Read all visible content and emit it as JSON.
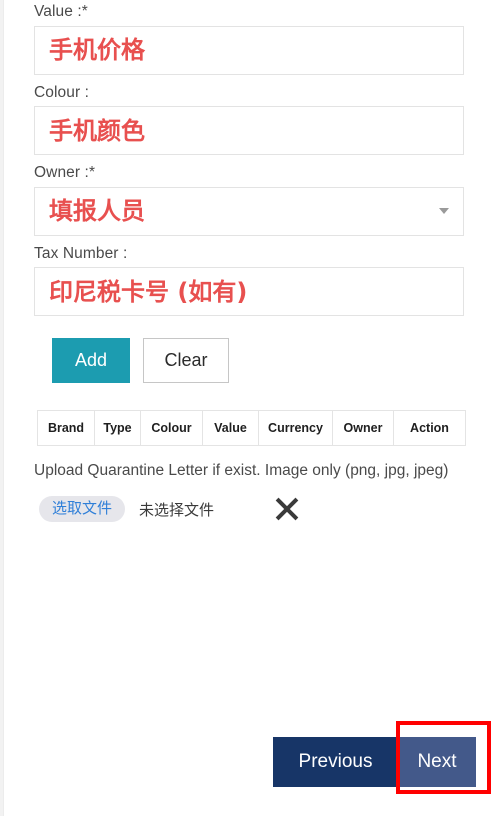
{
  "form": {
    "fields": [
      {
        "label": "Value :*",
        "value": "手机价格",
        "type": "text",
        "name": "value"
      },
      {
        "label": "Colour :",
        "value": "手机颜色",
        "type": "text",
        "name": "colour"
      },
      {
        "label": "Owner :*",
        "value": "填报人员",
        "type": "select",
        "name": "owner"
      },
      {
        "label": "Tax Number :",
        "value": "印尼税卡号 (如有)",
        "type": "text",
        "name": "tax-number"
      }
    ],
    "actions": {
      "add_label": "Add",
      "clear_label": "Clear"
    }
  },
  "table": {
    "headers": [
      "Brand",
      "Type",
      "Colour",
      "Value",
      "Currency",
      "Owner",
      "Action"
    ],
    "rows": []
  },
  "upload": {
    "note": "Upload Quarantine Letter if exist. Image only (png, jpg, jpeg)",
    "choose_file_label": "选取文件",
    "file_status": "未选择文件",
    "remove_icon": "close-x-icon"
  },
  "navigation": {
    "previous_label": "Previous",
    "next_label": "Next"
  },
  "colors": {
    "cn_text_red": "#e8504f",
    "add_button_teal": "#1c9cb0",
    "previous_navy": "#173567",
    "next_slate": "#43598a",
    "highlight_red": "#ff0000",
    "file_button_blue": "#2f7fd8"
  }
}
